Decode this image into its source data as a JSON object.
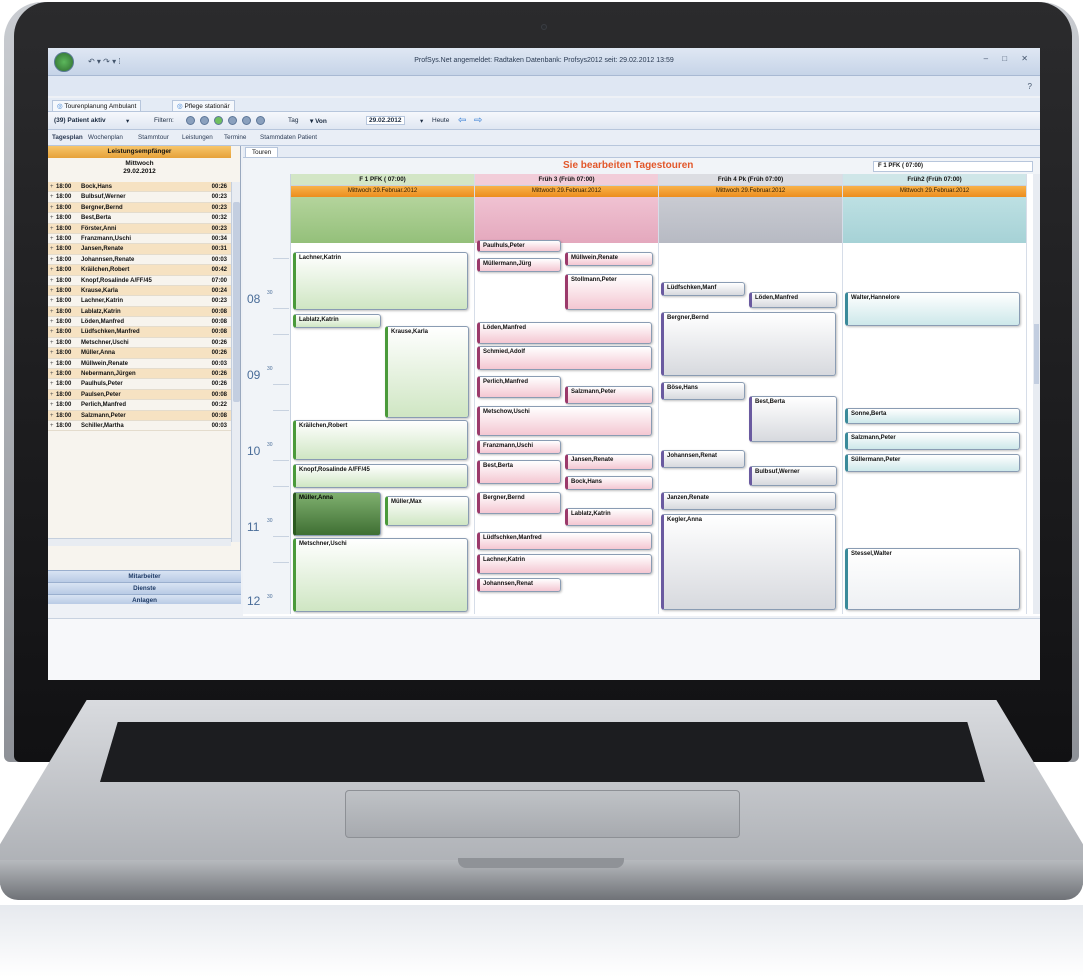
{
  "window": {
    "title": "ProfSys.Net angemeldet: Radtaken Datenbank: Profsys2012 seit: 29.02.2012 13:59",
    "quick_access": "↶ ▾ ↷ ▾ ⁞",
    "controls": "– □ ✕",
    "help": "?"
  },
  "tabs": [
    {
      "label": "Tourenplanung Ambulant"
    },
    {
      "label": "Pflege stationär"
    }
  ],
  "toolbar": {
    "patient_select": "(39) Patient aktiv",
    "filter_label": "Filtern:",
    "tag_label": "Tag",
    "von_label": "▾ Von",
    "date_value": "29.02.2012",
    "heute_label": "Heute"
  },
  "subnav": [
    "Tagesplan",
    "Wochenplan",
    "Stammtour",
    "Leistungen",
    "Termine",
    "Stammdaten Patient"
  ],
  "left_panel": {
    "header": "Leistungsempfänger",
    "weekday": "Mittwoch",
    "date": "29.02.2012",
    "rows": [
      {
        "time": "18:00",
        "name": "Bock,Hans",
        "dur": "00:26"
      },
      {
        "time": "18:00",
        "name": "Bulbsuf,Werner",
        "dur": "00:23"
      },
      {
        "time": "18:00",
        "name": "Bergner,Bernd",
        "dur": "00:23"
      },
      {
        "time": "18:00",
        "name": "Best,Berta",
        "dur": "00:32"
      },
      {
        "time": "18:00",
        "name": "Förster,Anni",
        "dur": "00:23"
      },
      {
        "time": "18:00",
        "name": "Franzmann,Uschi",
        "dur": "00:34"
      },
      {
        "time": "18:00",
        "name": "Jansen,Renate",
        "dur": "00:31"
      },
      {
        "time": "18:00",
        "name": "Johannsen,Renate",
        "dur": "00:03"
      },
      {
        "time": "18:00",
        "name": "Kräilchen,Robert",
        "dur": "00:42"
      },
      {
        "time": "18:00",
        "name": "Knopf,Rosalinde A/FF/45",
        "dur": "07:00"
      },
      {
        "time": "18:00",
        "name": "Krause,Karla",
        "dur": "00:24"
      },
      {
        "time": "18:00",
        "name": "Lachner,Katrin",
        "dur": "00:23"
      },
      {
        "time": "18:00",
        "name": "Lablatz,Katrin",
        "dur": "00:08"
      },
      {
        "time": "18:00",
        "name": "Löden,Manfred",
        "dur": "00:08"
      },
      {
        "time": "18:00",
        "name": "Lüdfschken,Manfred",
        "dur": "00:08"
      },
      {
        "time": "18:00",
        "name": "Metschner,Uschi",
        "dur": "00:26"
      },
      {
        "time": "18:00",
        "name": "Müller,Anna",
        "dur": "00:26"
      },
      {
        "time": "18:00",
        "name": "Müllwein,Renate",
        "dur": "00:03"
      },
      {
        "time": "18:00",
        "name": "Nebermann,Jürgen",
        "dur": "00:26"
      },
      {
        "time": "18:00",
        "name": "Paulhuls,Peter",
        "dur": "00:26"
      },
      {
        "time": "18:00",
        "name": "Paulsen,Peter",
        "dur": "00:08"
      },
      {
        "time": "18:00",
        "name": "Perlich,Manfred",
        "dur": "00:22"
      },
      {
        "time": "18:00",
        "name": "Salzmann,Peter",
        "dur": "00:08"
      },
      {
        "time": "18:00",
        "name": "Schiller,Martha",
        "dur": "00:03"
      }
    ],
    "buttons": [
      "Mitarbeiter",
      "Dienste",
      "Anlagen"
    ]
  },
  "main": {
    "tab": "Touren",
    "banner": "Sie bearbeiten Tagestouren",
    "right_select": "F 1 PFK ( 07:00)",
    "hours": [
      "08",
      "09",
      "10",
      "11",
      "12"
    ],
    "minute_label": "30",
    "tours": [
      {
        "title": "F 1 PFK ( 07:00)",
        "date": "Mittwoch 29.Februar.2012"
      },
      {
        "title": "Früh 3 (Früh 07:00)",
        "date": "Mittwoch 29.Februar.2012"
      },
      {
        "title": "Früh 4 Pk (Früh 07:00)",
        "date": "Mittwoch 29.Februar.2012"
      },
      {
        "title": "Früh2 (Früh 07:00)",
        "date": "Mittwoch 29.Februar.2012"
      }
    ],
    "appointments": {
      "col1": [
        "Lachner,Katrin",
        "Lablatz,Katrin",
        "Krause,Karla",
        "Kräilchen,Robert",
        "Knopf,Rosalinde A/FF/45",
        "Müller,Anna",
        "Müller,Max",
        "Metschner,Uschi"
      ],
      "col2": [
        "Paulhuls,Peter",
        "Müllermann,Jürg",
        "Müllwein,Renate",
        "Stollmann,Peter",
        "Löden,Manfred",
        "Schmied,Adolf",
        "Perlich,Manfred",
        "Salzmann,Peter",
        "Metschow,Uschi",
        "Franzmann,Uschi",
        "Jansen,Renate",
        "Best,Berta",
        "Bock,Hans",
        "Bergner,Bernd",
        "Lablatz,Katrin",
        "Lüdfschken,Manfred",
        "Lachner,Katrin",
        "Johannsen,Renat"
      ],
      "col3": [
        "Lüdfschken,Manf",
        "Löden,Manfred",
        "Bergner,Bernd",
        "Böse,Hans",
        "Best,Berta",
        "Johannsen,Renat",
        "Bulbsuf,Werner",
        "Janzen,Renate",
        "Kegler,Anna"
      ],
      "col4": [
        "Walter,Hannelore",
        "Sonne,Berta",
        "Salzmann,Peter",
        "Süllermann,Peter",
        "Stessel,Walter"
      ]
    }
  }
}
